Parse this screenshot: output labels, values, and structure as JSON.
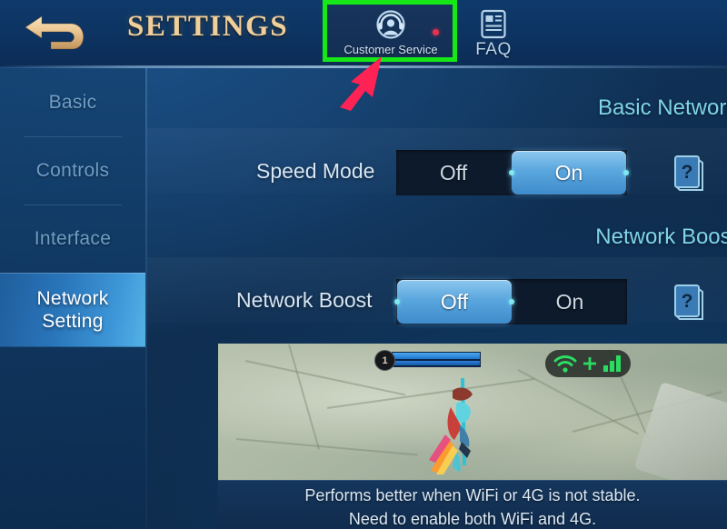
{
  "header": {
    "title": "SETTINGS",
    "back_icon": "back-arrow-icon",
    "back_color": "#f0cf9a",
    "buttons": [
      {
        "id": "customer-service",
        "label": "Customer Service",
        "icon": "headset-agent-icon",
        "badge_dot": true,
        "badge_color": "#e8304f",
        "highlighted": true
      },
      {
        "id": "faq",
        "label": "FAQ",
        "icon": "article-document-icon",
        "badge_dot": false,
        "highlighted": false
      }
    ]
  },
  "annotations": {
    "highlight_box_color": "#16e818",
    "arrow_color": "#ff2255",
    "arrow_target": "Customer Service"
  },
  "sidebar": {
    "items": [
      {
        "label": "Basic",
        "selected": false
      },
      {
        "label": "Controls",
        "selected": false
      },
      {
        "label": "Interface",
        "selected": false
      },
      {
        "label": "Network\nSetting",
        "label_line1": "Network",
        "label_line2": "Setting",
        "selected": true
      }
    ]
  },
  "main": {
    "sections": [
      {
        "heading": "Basic Network S",
        "setting_label": "Speed Mode",
        "options": [
          "Off",
          "On"
        ],
        "selected": "On",
        "help_icon": "question-book-icon"
      },
      {
        "heading": "Network Boost S",
        "setting_label": "Network Boost",
        "options": [
          "Off",
          "On"
        ],
        "selected": "Off",
        "help_icon": "question-book-icon"
      }
    ],
    "preview": {
      "level_badge": "1",
      "network_status_icons": [
        "wifi-icon",
        "plus-icon",
        "signal-bars-icon"
      ],
      "network_status_color": "#2bdc62",
      "caption_line1": "Performs better when WiFi or 4G is not stable.",
      "caption_line2": "Need to enable both WiFi and 4G."
    }
  },
  "colors": {
    "accent_cyan": "#7fd4e8",
    "toggle_active": "#5aa6de",
    "title_gold": "#f0cf9a",
    "sidebar_selected": "#3e97d8"
  }
}
